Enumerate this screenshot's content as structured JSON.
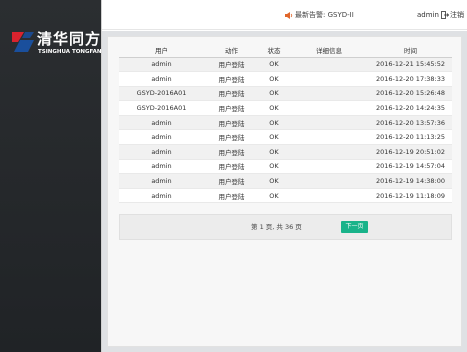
{
  "brand": {
    "name_cn": "清华同方",
    "name_en": "TSINGHUA TONGFANG",
    "colors": {
      "red": "#d9232e",
      "blue": "#1a4f9c"
    }
  },
  "header": {
    "notice_label": "最新告警: GSYD-II",
    "user": "admin",
    "logout_label": "注销"
  },
  "table": {
    "columns": [
      "用户",
      "动作",
      "状态",
      "详细信息",
      "时间"
    ],
    "rows": [
      {
        "user": "admin",
        "action": "用户登陆",
        "status": "OK",
        "detail": "",
        "time": "2016-12-21 15:45:52"
      },
      {
        "user": "admin",
        "action": "用户登陆",
        "status": "OK",
        "detail": "",
        "time": "2016-12-20 17:38:33"
      },
      {
        "user": "GSYD-2016A01",
        "action": "用户登陆",
        "status": "OK",
        "detail": "",
        "time": "2016-12-20 15:26:48"
      },
      {
        "user": "GSYD-2016A01",
        "action": "用户登陆",
        "status": "OK",
        "detail": "",
        "time": "2016-12-20 14:24:35"
      },
      {
        "user": "admin",
        "action": "用户登陆",
        "status": "OK",
        "detail": "",
        "time": "2016-12-20 13:57:36"
      },
      {
        "user": "admin",
        "action": "用户登陆",
        "status": "OK",
        "detail": "",
        "time": "2016-12-20 11:13:25"
      },
      {
        "user": "admin",
        "action": "用户登陆",
        "status": "OK",
        "detail": "",
        "time": "2016-12-19 20:51:02"
      },
      {
        "user": "admin",
        "action": "用户登陆",
        "status": "OK",
        "detail": "",
        "time": "2016-12-19 14:57:04"
      },
      {
        "user": "admin",
        "action": "用户登陆",
        "status": "OK",
        "detail": "",
        "time": "2016-12-19 14:38:00"
      },
      {
        "user": "admin",
        "action": "用户登陆",
        "status": "OK",
        "detail": "",
        "time": "2016-12-19 11:18:09"
      }
    ]
  },
  "pagination": {
    "info": "第 1 页, 共 36 页",
    "current_page": 1,
    "total_pages": 36,
    "next_label": "下一页",
    "next_color": "#19b38a"
  },
  "icons": {
    "notice": "speaker-icon",
    "logout": "logout-icon"
  }
}
